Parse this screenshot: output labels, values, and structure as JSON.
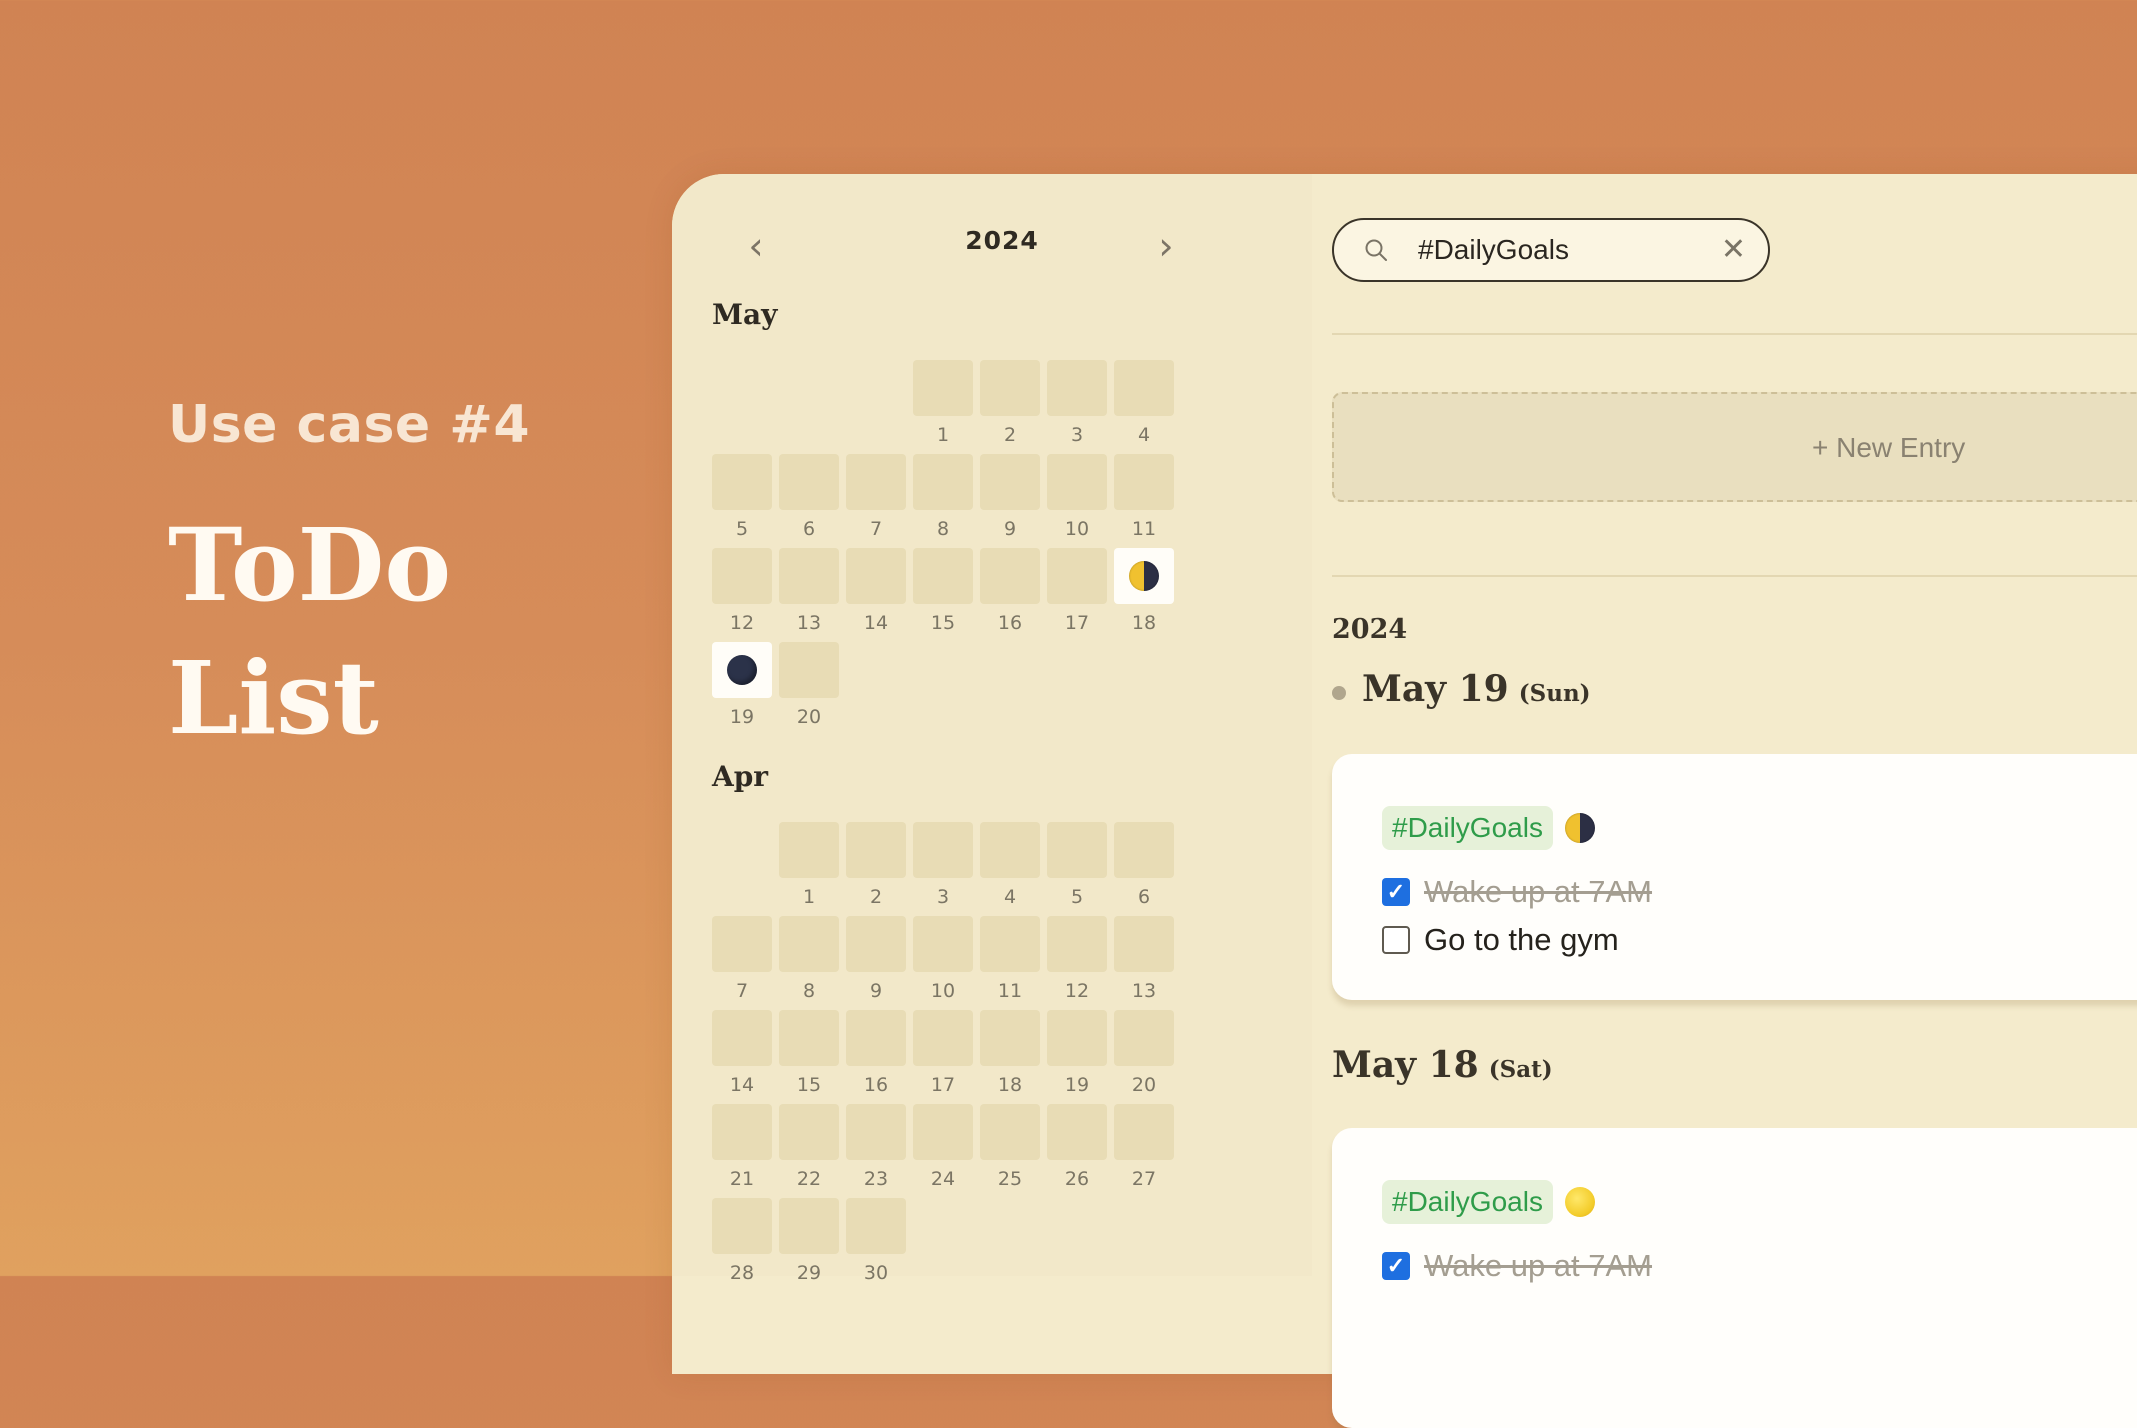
{
  "hero": {
    "subtitle": "Use case #4",
    "title_line1": "ToDo",
    "title_line2": "List"
  },
  "calendar": {
    "prev_icon": "chevron-left-icon",
    "next_icon": "chevron-right-icon",
    "year": "2024",
    "months": [
      {
        "name": "May",
        "days": [
          {
            "n": "1"
          },
          {
            "n": "2"
          },
          {
            "n": "3"
          },
          {
            "n": "4"
          },
          {
            "n": "5"
          },
          {
            "n": "6"
          },
          {
            "n": "7"
          },
          {
            "n": "8"
          },
          {
            "n": "9"
          },
          {
            "n": "10"
          },
          {
            "n": "11"
          },
          {
            "n": "12"
          },
          {
            "n": "13"
          },
          {
            "n": "14"
          },
          {
            "n": "15"
          },
          {
            "n": "16"
          },
          {
            "n": "17"
          },
          {
            "n": "18",
            "moon": "half"
          },
          {
            "n": "19",
            "moon": "new"
          },
          {
            "n": "20"
          }
        ]
      },
      {
        "name": "Apr",
        "days": [
          {
            "n": "1"
          },
          {
            "n": "2"
          },
          {
            "n": "3"
          },
          {
            "n": "4"
          },
          {
            "n": "5"
          },
          {
            "n": "6"
          },
          {
            "n": "7"
          },
          {
            "n": "8"
          },
          {
            "n": "9"
          },
          {
            "n": "10"
          },
          {
            "n": "11"
          },
          {
            "n": "12"
          },
          {
            "n": "13"
          },
          {
            "n": "14"
          },
          {
            "n": "15"
          },
          {
            "n": "16"
          },
          {
            "n": "17"
          },
          {
            "n": "18"
          },
          {
            "n": "19"
          },
          {
            "n": "20"
          },
          {
            "n": "21"
          },
          {
            "n": "22"
          },
          {
            "n": "23"
          },
          {
            "n": "24"
          },
          {
            "n": "25"
          },
          {
            "n": "26"
          },
          {
            "n": "27"
          },
          {
            "n": "28"
          },
          {
            "n": "29"
          },
          {
            "n": "30"
          }
        ]
      }
    ]
  },
  "search": {
    "icon": "search-icon",
    "value": "#DailyGoals",
    "clear_icon": "close-icon",
    "clear_glyph": "✕"
  },
  "new_entry": {
    "label": "+ New Entry"
  },
  "entries": {
    "year": "2024",
    "list": [
      {
        "date": "May 19",
        "weekday": "(Sun)",
        "tag": "#DailyGoals",
        "moon": "half",
        "tasks": [
          {
            "text": "Wake up at 7AM",
            "done": true
          },
          {
            "text": "Go to the gym",
            "done": false
          }
        ]
      },
      {
        "date": "May 18",
        "weekday": "(Sat)",
        "tag": "#DailyGoals",
        "moon": "full",
        "tasks": [
          {
            "text": "Wake up at 7AM",
            "done": true
          }
        ]
      }
    ]
  },
  "colors": {
    "accent_blue": "#1e6fe0",
    "tag_green": "#2f9c4a",
    "background_orange": "#d08353",
    "panel": "#f4ebcc"
  }
}
